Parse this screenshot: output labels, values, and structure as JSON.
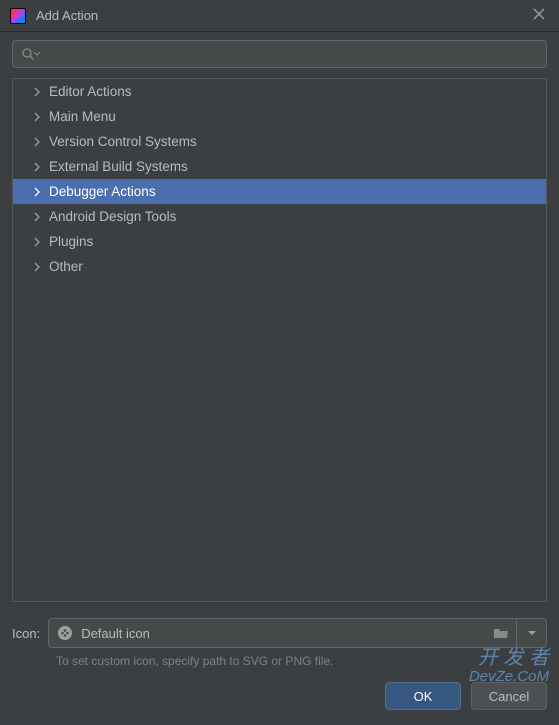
{
  "window": {
    "title": "Add Action"
  },
  "search": {
    "value": "",
    "placeholder": ""
  },
  "tree": {
    "items": [
      {
        "label": "Editor Actions",
        "selected": false
      },
      {
        "label": "Main Menu",
        "selected": false
      },
      {
        "label": "Version Control Systems",
        "selected": false
      },
      {
        "label": "External Build Systems",
        "selected": false
      },
      {
        "label": "Debugger Actions",
        "selected": true
      },
      {
        "label": "Android Design Tools",
        "selected": false
      },
      {
        "label": "Plugins",
        "selected": false
      },
      {
        "label": "Other",
        "selected": false
      }
    ]
  },
  "icon_section": {
    "label": "Icon:",
    "value": "Default icon",
    "hint": "To set custom icon, specify path to SVG or PNG file."
  },
  "buttons": {
    "ok": "OK",
    "cancel": "Cancel"
  },
  "watermark": {
    "line1": "开 发 者",
    "line2": "DevZe.CoM"
  }
}
